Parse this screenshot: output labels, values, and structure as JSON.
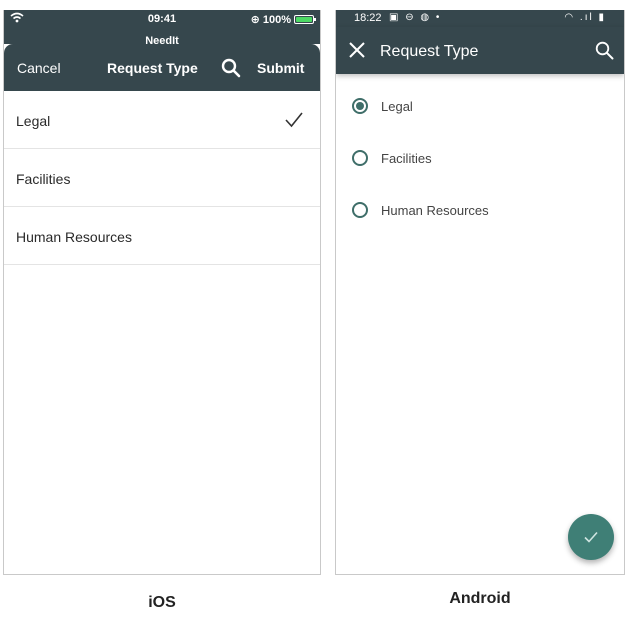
{
  "ios": {
    "status": {
      "time": "09:41",
      "battery": "100%"
    },
    "behind_title": "NeedIt",
    "nav": {
      "cancel_label": "Cancel",
      "title": "Request Type",
      "submit_label": "Submit",
      "search_icon": "search-icon"
    },
    "items": [
      {
        "label": "Legal",
        "selected": true
      },
      {
        "label": "Facilities",
        "selected": false
      },
      {
        "label": "Human Resources",
        "selected": false
      }
    ],
    "caption": "iOS"
  },
  "android": {
    "status": {
      "time": "18:22",
      "icons": "▣ ⊖ ◍ •",
      "right_icons": "◠ .ıl ▮"
    },
    "bar": {
      "title": "Request Type",
      "close_icon": "close-icon",
      "search_icon": "search-icon"
    },
    "items": [
      {
        "label": "Legal",
        "selected": true
      },
      {
        "label": "Facilities",
        "selected": false
      },
      {
        "label": "Human Resources",
        "selected": false
      }
    ],
    "fab_icon": "check-icon",
    "caption": "Android"
  },
  "colors": {
    "header": "#36474d",
    "accent": "#3f7f76",
    "radio": "#3f6e69"
  }
}
